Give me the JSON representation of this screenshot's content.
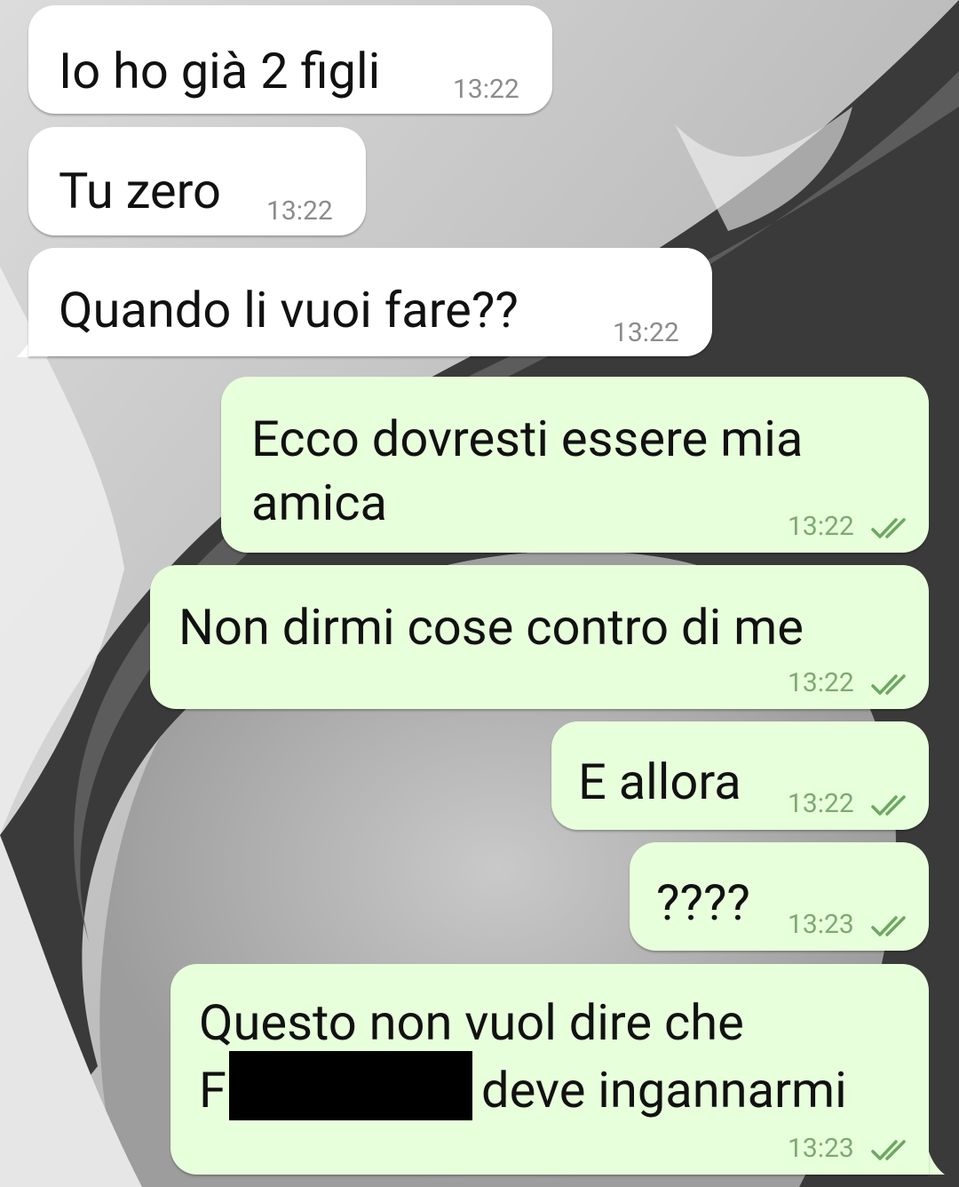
{
  "theme": {
    "incoming_bubble": "#ffffff",
    "outgoing_bubble": "#e7ffdb",
    "read_check_color": "#4fc3f7",
    "wallpaper": "black-and-white ocean wave photo"
  },
  "messages": [
    {
      "direction": "incoming",
      "text": "Io ho già 2 figli",
      "time": "13:22"
    },
    {
      "direction": "incoming",
      "text": "Tu zero",
      "time": "13:22"
    },
    {
      "direction": "incoming",
      "text": "Quando li vuoi fare??",
      "time": "13:22"
    },
    {
      "direction": "outgoing",
      "line1": "Ecco dovresti essere mia",
      "line2": "amica",
      "time": "13:22",
      "status": "read"
    },
    {
      "direction": "outgoing",
      "text": "Non dirmi cose contro di me",
      "time": "13:22",
      "status": "read"
    },
    {
      "direction": "outgoing",
      "text": "E allora",
      "time": "13:22",
      "status": "read"
    },
    {
      "direction": "outgoing",
      "text": "????",
      "time": "13:23",
      "status": "read"
    },
    {
      "direction": "outgoing",
      "line1": "Questo non vuol dire che",
      "line2_start": "F",
      "line2_end": "deve ingannarmi",
      "time": "13:23",
      "status": "read",
      "redacted": true
    }
  ]
}
